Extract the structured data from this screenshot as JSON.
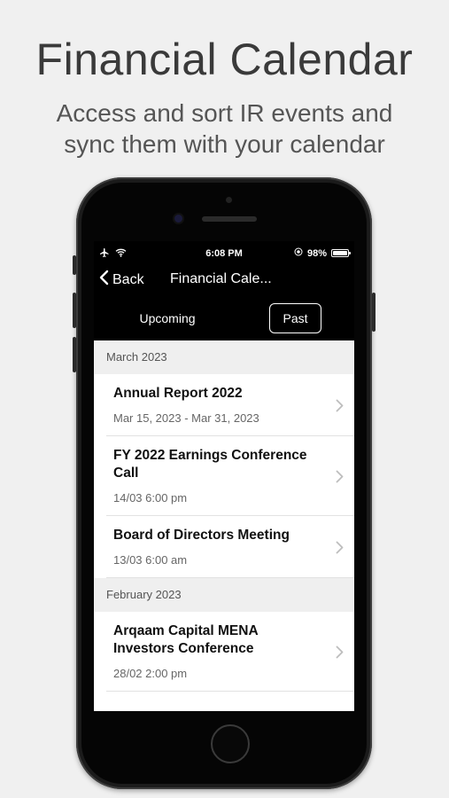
{
  "promo": {
    "title": "Financial Calendar",
    "subtitle_line1": "Access and sort IR events and",
    "subtitle_line2": "sync them with your calendar"
  },
  "status_bar": {
    "time": "6:08 PM",
    "battery": "98%",
    "battery_level": 0.98,
    "icons": [
      "airplane-icon",
      "wifi-icon",
      "location-icon",
      "battery-icon"
    ]
  },
  "nav": {
    "back_label": "Back",
    "title": "Financial Cale..."
  },
  "segments": {
    "upcoming_label": "Upcoming",
    "past_label": "Past",
    "selected": "Past"
  },
  "sections": [
    {
      "header": "March 2023",
      "events": [
        {
          "title": "Annual Report 2022",
          "date": "Mar 15, 2023 - Mar 31, 2023"
        },
        {
          "title": "FY 2022 Earnings Conference Call",
          "date": "14/03 6:00 pm"
        },
        {
          "title": "Board of Directors Meeting",
          "date": "13/03 6:00 am"
        }
      ]
    },
    {
      "header": "February 2023",
      "events": [
        {
          "title": "Arqaam Capital MENA Investors Conference",
          "date": "28/02 2:00 pm"
        }
      ]
    }
  ],
  "colors": {
    "background": "#f0f0f0",
    "phone_body": "#1b1b1b",
    "screen": "#000000",
    "section_header_bg": "#efefef"
  }
}
